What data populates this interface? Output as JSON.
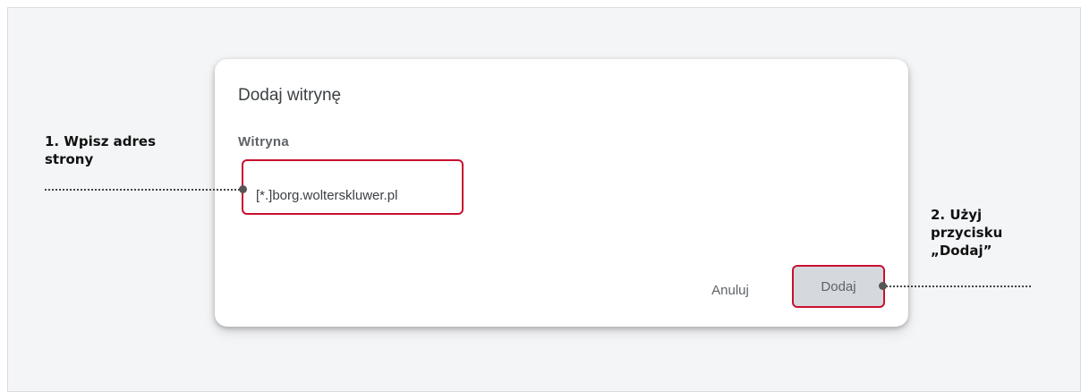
{
  "dialog": {
    "title": "Dodaj witrynę",
    "field_label": "Witryna",
    "site_value": "[*.]borg.wolterskluwer.pl",
    "cancel_label": "Anuluj",
    "add_label": "Dodaj"
  },
  "annotations": {
    "step1": "1. Wpisz adres strony",
    "step2": "2. Użyj przycisku „Dodaj”"
  },
  "colors": {
    "highlight": "#c8102e",
    "add_button_bg": "#d5d9de",
    "text": "#3c4043"
  }
}
